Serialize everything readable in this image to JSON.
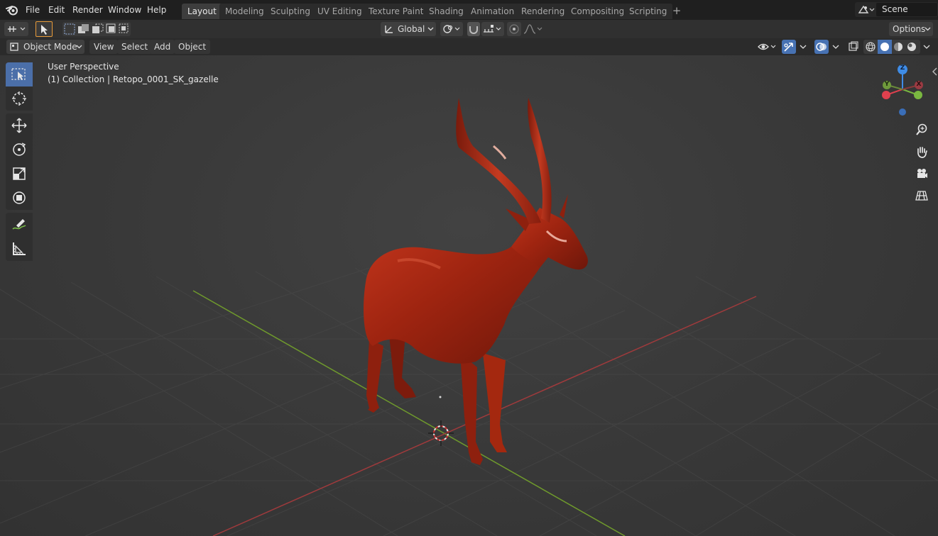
{
  "menu": {
    "items": [
      "File",
      "Edit",
      "Render",
      "Window",
      "Help"
    ]
  },
  "workspaces": {
    "tabs": [
      "Layout",
      "Modeling",
      "Sculpting",
      "UV Editing",
      "Texture Paint",
      "Shading",
      "Animation",
      "Rendering",
      "Compositing",
      "Scripting"
    ],
    "active": "Layout",
    "add_label": "+"
  },
  "scene": {
    "name": "Scene"
  },
  "tool_header": {
    "transform_orientation": "Global",
    "options_label": "Options"
  },
  "view_header": {
    "mode": "Object Mode",
    "menus": [
      "View",
      "Select",
      "Add",
      "Object"
    ]
  },
  "viewport": {
    "perspective_label": "User Perspective",
    "collection_label": "(1) Collection | Retopo_0001_SK_gazelle",
    "gizmo": {
      "z": "Z",
      "y": "Y",
      "x": "X"
    }
  },
  "colors": {
    "accent": "#4772b3",
    "x_axis": "#e0404e",
    "y_axis": "#7ab840",
    "z_axis": "#3f8ce6",
    "model": "#a82a16"
  }
}
